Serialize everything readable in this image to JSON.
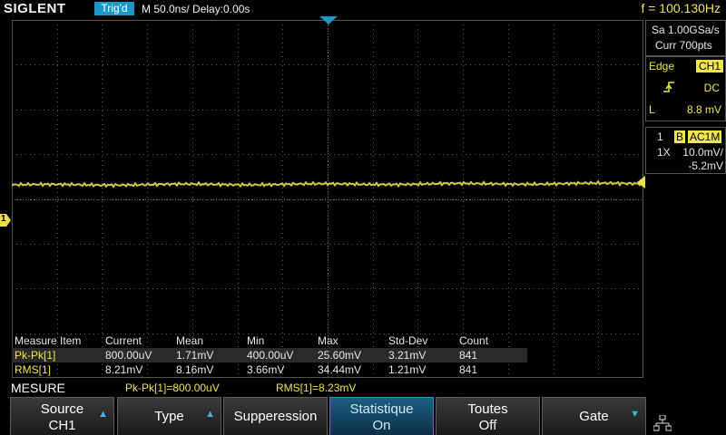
{
  "header": {
    "brand": "SIGLENT",
    "trigger_status": "Trig'd",
    "timebase": "M 50.0ns/",
    "delay": "Delay:0.00s",
    "frequency": "f = 100.130Hz"
  },
  "side_panel": {
    "sample_rate": "Sa 1.00GSa/s",
    "memory_depth": "Curr 700pts",
    "trigger_type": "Edge",
    "trigger_source": "CH1",
    "slope_icon": "rising-edge-icon",
    "coupling": "DC",
    "level_label": "L",
    "level_value": "8.8 mV",
    "channel_number": "1",
    "bandwidth_flag": "B",
    "channel_coupling": "AC1M",
    "probe": "1X",
    "volts_div": "10.0mV/",
    "offset": "-5.2mV"
  },
  "measurements": {
    "headers": [
      "Measure Item",
      "Current",
      "Mean",
      "Min",
      "Max",
      "Std-Dev",
      "Count"
    ],
    "rows": [
      [
        "Pk-Pk[1]",
        "800.00uV",
        "1.71mV",
        "400.00uV",
        "25.60mV",
        "3.21mV",
        "841"
      ],
      [
        "RMS[1]",
        "8.21mV",
        "8.16mV",
        "3.66mV",
        "34.44mV",
        "1.21mV",
        "841"
      ]
    ]
  },
  "status": {
    "menu": "MESURE",
    "quick1": "Pk-Pk[1]=800.00uV",
    "quick2": "RMS[1]=8.23mV"
  },
  "softkeys": [
    {
      "line1": "Source",
      "line2": "CH1"
    },
    {
      "line1": "Type"
    },
    {
      "line1": "Supperession"
    },
    {
      "line1": "Statistique",
      "line2": "On"
    },
    {
      "line1": "Toutes",
      "line2": "Off"
    },
    {
      "line1": "Gate"
    }
  ],
  "markers": {
    "channel_marker": "1"
  },
  "colors": {
    "trace": "#e8e04a",
    "accent": "#1c97c9",
    "grid": "#5a5a5a"
  }
}
